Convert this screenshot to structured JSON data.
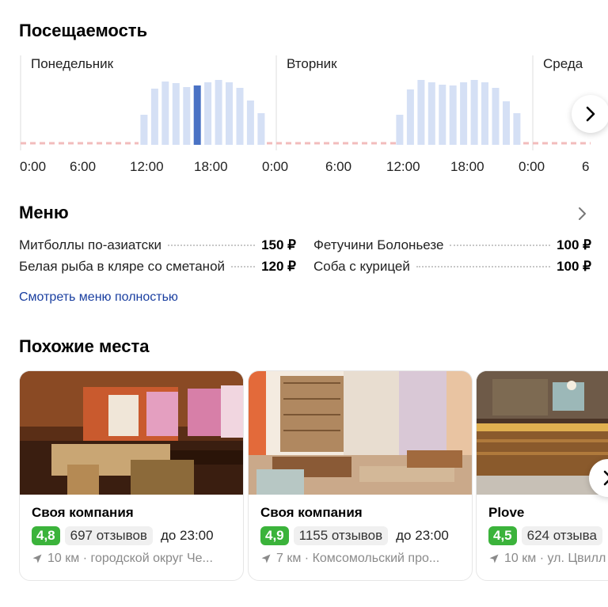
{
  "attendance": {
    "title": "Посещаемость",
    "days": [
      "Понедельник",
      "Вторник",
      "Среда"
    ],
    "ticks": [
      "0:00",
      "6:00",
      "12:00",
      "18:00",
      "0:00",
      "6:00",
      "12:00",
      "18:00",
      "0:00",
      "6"
    ]
  },
  "chart_data": {
    "type": "bar",
    "title": "Посещаемость",
    "categories": [
      "11:00",
      "12:00",
      "13:00",
      "14:00",
      "15:00",
      "16:00",
      "17:00",
      "18:00",
      "19:00",
      "20:00",
      "21:00",
      "22:00"
    ],
    "series": [
      {
        "name": "Понедельник",
        "values": [
          38,
          71,
          80,
          78,
          73,
          75,
          79,
          82,
          79,
          72,
          56,
          40
        ]
      },
      {
        "name": "Вторник",
        "values": [
          38,
          70,
          82,
          79,
          76,
          75,
          79,
          82,
          79,
          72,
          55,
          40
        ]
      }
    ],
    "highlight": {
      "series": "Понедельник",
      "category": "16:00"
    },
    "ylim": [
      0,
      100
    ],
    "colors": {
      "bar": "#d5e0f5",
      "highlight": "#4a72c4",
      "baseline": "#f2bcbc"
    }
  },
  "menu": {
    "title": "Меню",
    "items": [
      {
        "name": "Митболлы по-азиатски",
        "price": "150 ₽"
      },
      {
        "name": "Белая рыба в кляре со сметаной",
        "price": "120 ₽"
      },
      {
        "name": "Фетучини Болоньезе",
        "price": "100 ₽"
      },
      {
        "name": "Соба с курицей",
        "price": "100 ₽"
      }
    ],
    "link": "Смотреть меню полностью"
  },
  "similar": {
    "title": "Похожие места",
    "cards": [
      {
        "name": "Своя компания",
        "rating": "4,8",
        "reviews": "697 отзывов",
        "hours": "до 23:00",
        "location": "10 км · городской округ Че..."
      },
      {
        "name": "Своя компания",
        "rating": "4,9",
        "reviews": "1155 отзывов",
        "hours": "до 23:00",
        "location": "7 км · Комсомольский про..."
      },
      {
        "name": "Plove",
        "rating": "4,5",
        "reviews": "624 отзыва",
        "hours": "",
        "location": "10 км · ул. Цвилл"
      }
    ]
  },
  "icons": [
    "chevron-right-icon",
    "location-arrow-icon"
  ],
  "colors": {
    "link": "#1a3fa0",
    "rating": "#3bb33b"
  }
}
